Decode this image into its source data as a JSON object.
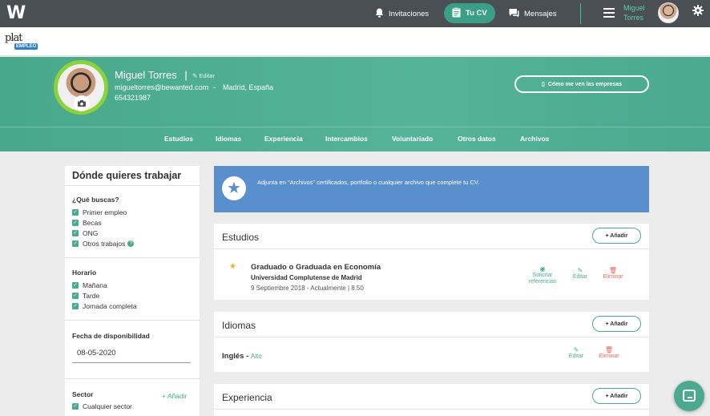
{
  "topbar": {
    "nav": [
      {
        "label": "Invitaciones",
        "icon": "bell-icon"
      },
      {
        "label": "Tu CV",
        "icon": "clipboard-icon"
      },
      {
        "label": "Mensajes",
        "icon": "chat-icon"
      }
    ],
    "user_name": "Miguel Torres"
  },
  "brand": {
    "text": "plat",
    "badge": "EMPLEO"
  },
  "profile": {
    "name": "Miguel Torres",
    "separator": "|",
    "edit_label": "Editar",
    "email": "migueltorres@bewanted.com",
    "dash": "-",
    "location": "Madrid, España",
    "phone": "654321987",
    "view_button": "Cómo me ven las empresas"
  },
  "tabs": [
    "Estudios",
    "Idiomas",
    "Experiencia",
    "Intercambios",
    "Voluntariado",
    "Otros datos",
    "Archivos"
  ],
  "sidebar": {
    "title": "Dónde quieres trabajar",
    "what_label": "¿Qué buscas?",
    "what_options": [
      "Primer empleo",
      "Becas",
      "ONG",
      "Otros trabajos"
    ],
    "schedule_label": "Horario",
    "schedule_options": [
      "Mañana",
      "Tarde",
      "Jornada completa"
    ],
    "availability_label": "Fecha de disponibilidad",
    "availability_value": "08-05-2020",
    "sector_label": "Sector",
    "sector_add": "+ Añadir",
    "sector_options": [
      "Cualquier sector"
    ]
  },
  "banner": {
    "text": "Adjunta en \"Archivos\" certificados, portfolio o cualquier archivo que complete tu CV."
  },
  "sections": {
    "add_label": "+ Añadir",
    "estudios": {
      "title": "Estudios",
      "entry": {
        "degree": "Graduado o Graduada en Economía",
        "school": "Universidad Complutense de Madrid",
        "dates": "9 Septiembre 2018 - Actualmente | 8.50"
      },
      "actions": {
        "references": "Solicitar referencias",
        "edit": "Editar",
        "delete": "Eliminar"
      }
    },
    "idiomas": {
      "title": "Idiomas",
      "language": "Inglés",
      "dash": "-",
      "level": "Alto",
      "actions": {
        "edit": "Editar",
        "delete": "Eliminar"
      }
    },
    "experiencia": {
      "title": "Experiencia"
    }
  },
  "colors": {
    "accent": "#4aa98e",
    "banner": "#5a8fcd",
    "topbar": "#4a4f53",
    "delete": "#e0685d",
    "avatar_ring": "#8cd23c"
  }
}
